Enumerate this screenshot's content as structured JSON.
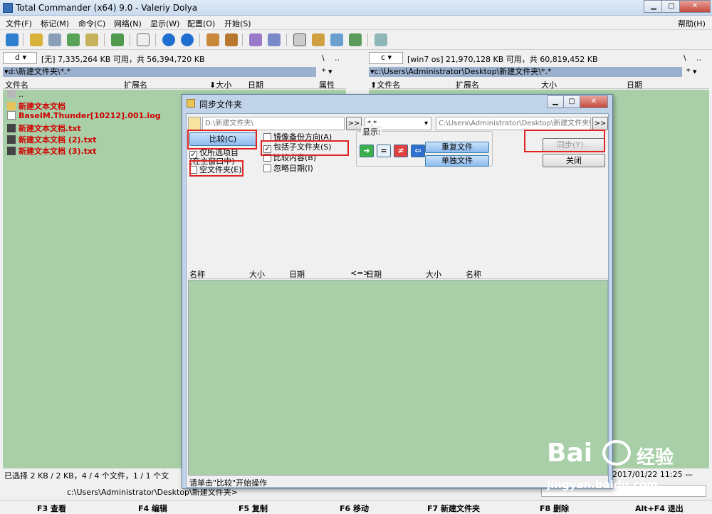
{
  "window": {
    "title": "Total Commander (x64) 9.0 - Valeriy Dolya"
  },
  "menu": [
    "文件(F)",
    "标记(M)",
    "命令(C)",
    "网络(N)",
    "显示(W)",
    "配置(O)",
    "开始(S)",
    "帮助(H)"
  ],
  "left": {
    "drive": "d",
    "drive_info": "[无] 7,335,264 KB 可用，共 56,394,720 KB",
    "path": "▾d:\\新建文件夹\\*.*",
    "filter": "*",
    "headers": [
      "文件名",
      "扩展名",
      "⬇大小",
      "日期",
      "属性"
    ],
    "files": [
      {
        "name": "..",
        "type": "up"
      },
      {
        "name": "新建文本文档",
        "type": "folder"
      },
      {
        "name": "BaseIM.Thunder[10212].001.log",
        "type": "file"
      },
      {
        "name": "新建文本文档.txt",
        "type": "file"
      },
      {
        "name": "新建文本文档 (2).txt",
        "type": "file"
      },
      {
        "name": "新建文本文档 (3).txt",
        "type": "file"
      }
    ],
    "status": "已选择 2 KB / 2 KB，4 / 4 个文件，1 / 1 个文"
  },
  "right": {
    "drive": "c",
    "drive_info": "[win7 os]  21,970,128 KB 可用，共 60,819,452 KB",
    "path": "▾c:\\Users\\Administrator\\Desktop\\新建文件夹\\*.*",
    "filter": "*",
    "headers": [
      "⬆文件名",
      "扩展名",
      "大小",
      "日期"
    ],
    "status": "2017/01/22 11:25 —"
  },
  "cmdline": "c:\\Users\\Administrator\\Desktop\\新建文件夹>",
  "fkeys": [
    "F3 查看",
    "F4 编辑",
    "F5 复制",
    "F6 移动",
    "F7 新建文件夹",
    "F8 删除",
    "Alt+F4 退出"
  ],
  "dialog": {
    "title": "同步文件夹",
    "left_path": "D:\\新建文件夹\\",
    "filter": "*.*",
    "right_path": "C:\\Users\\Administrator\\Desktop\\新建文件夹\\",
    "nav": ">>",
    "compare": "比较(C)",
    "only_selected": "仅所选项目",
    "in_main": "(在主窗口中)",
    "empty_dirs": "空文件夹(E)",
    "mirror": "镜像备份方向(A)",
    "subdirs": "包括子文件夹(S)",
    "by_content": "比较内容(B)",
    "ignore_date": "忽略日期(I)",
    "show_label": "显示:",
    "duplicates": "重复文件",
    "singles": "单独文件",
    "sync": "同步(Y)...",
    "close": "关闭",
    "list_headers": [
      "名称",
      "大小",
      "日期",
      "<=>",
      "日期",
      "大小",
      "名称"
    ],
    "status": "请单击\"比较\"开始操作"
  },
  "watermark": {
    "logo": "Bai",
    "logo2": "经验",
    "url": "jingyan.baidu.com"
  },
  "colors": {
    "panel": "#a8cfa8",
    "highlight": "#e02424",
    "file_red": "#d00000"
  }
}
